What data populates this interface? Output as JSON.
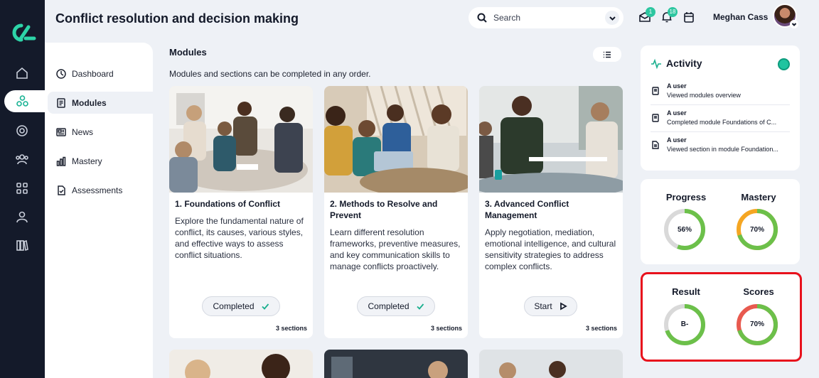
{
  "header": {
    "title": "Conflict resolution and decision making",
    "search_placeholder": "Search",
    "messages_badge": "1",
    "notifications_badge": "18",
    "user_name": "Meghan Cass"
  },
  "rail_icons": [
    "home-icon",
    "modules-icon",
    "target-icon",
    "users-icon",
    "grid-icon",
    "user-icon",
    "library-icon"
  ],
  "nav": {
    "items": [
      {
        "label": "Dashboard",
        "icon": "dashboard-icon"
      },
      {
        "label": "Modules",
        "icon": "modules-icon",
        "active": true
      },
      {
        "label": "News",
        "icon": "news-icon"
      },
      {
        "label": "Mastery",
        "icon": "mastery-icon"
      },
      {
        "label": "Assessments",
        "icon": "assessments-icon"
      }
    ]
  },
  "modules": {
    "title": "Modules",
    "subtitle": "Modules and sections can be completed in any order.",
    "cards": [
      {
        "title": "1. Foundations of Conflict",
        "desc": "Explore the fundamental nature of conflict, its causes, various styles, and effective ways to assess conflict situations.",
        "button": "Completed",
        "sections": "3 sections"
      },
      {
        "title": "2. Methods to Resolve and Prevent",
        "desc": "Learn different resolution frameworks, preventive measures, and key communication skills to manage conflicts proactively.",
        "button": "Completed",
        "sections": "3 sections"
      },
      {
        "title": "3. Advanced Conflict Management",
        "desc": "Apply negotiation, mediation, emotional intelligence, and cultural sensitivity strategies to address complex conflicts.",
        "button": "Start",
        "sections": "3 sections"
      }
    ]
  },
  "activity": {
    "title": "Activity",
    "entries": [
      {
        "user": "A user",
        "text": "Viewed modules overview"
      },
      {
        "user": "A user",
        "text": "Completed module Foundations of C..."
      },
      {
        "user": "A user",
        "text": "Viewed section in module Foundation..."
      }
    ]
  },
  "stats": {
    "progress": {
      "label": "Progress",
      "value": "56%",
      "fraction": 0.56
    },
    "mastery": {
      "label": "Mastery",
      "value": "70%",
      "fraction": 0.7
    },
    "result": {
      "label": "Result",
      "value": "B-"
    },
    "scores": {
      "label": "Scores",
      "value": "70%",
      "fraction": 0.7
    }
  },
  "colors": {
    "accent": "#1fc4a0",
    "green": "#6cc04a",
    "orange": "#f5a623",
    "red": "#e85a4f",
    "track": "#d9d9d9",
    "highlight": "#e8111c"
  }
}
